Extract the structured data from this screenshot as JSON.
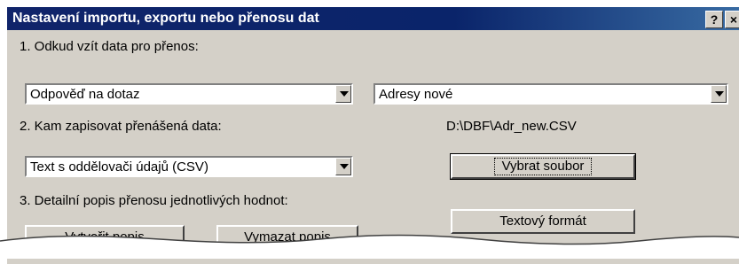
{
  "dialog": {
    "title": "Nastavení importu, exportu nebo přenosu dat",
    "help_label": "?",
    "close_label": "×"
  },
  "section1": {
    "label": "1. Odkud vzít data pro přenos:",
    "source_type": "Odpověď na dotaz",
    "source_name": "Adresy nové"
  },
  "section2": {
    "label": "2. Kam zapisovat přenášená data:",
    "target_format": "Text s oddělovači údajů (CSV)",
    "file_path": "D:\\DBF\\Adr_new.CSV",
    "select_file_label": "Vybrat soubor"
  },
  "section3": {
    "label": "3. Detailní popis přenosu jednotlivých hodnot:",
    "create_label": "Vytvořit popis",
    "delete_label": "Vymazat popis",
    "text_format_label": "Textový formát"
  }
}
